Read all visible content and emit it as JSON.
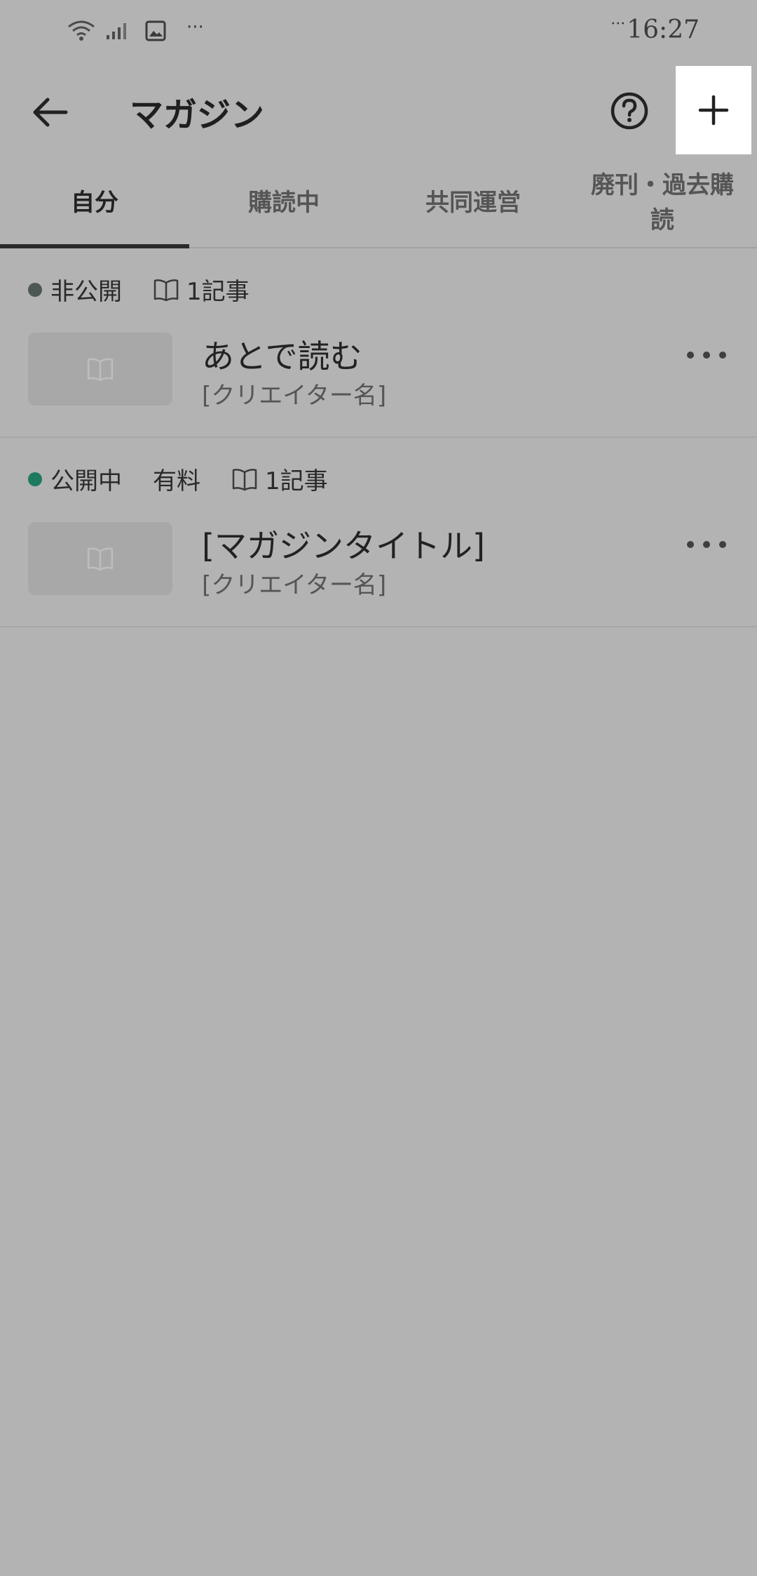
{
  "status_bar": {
    "time": "16:27",
    "left_dots": "···",
    "time_dots": "···",
    "icons": [
      "wifi-icon",
      "signal-icon",
      "image-icon"
    ]
  },
  "app_bar": {
    "title": "マガジン",
    "back_icon": "arrow-left-icon",
    "help_icon": "question-circle-icon",
    "add_icon": "plus-icon"
  },
  "tabs": [
    {
      "label": "自分",
      "active": true
    },
    {
      "label": "購読中",
      "active": false
    },
    {
      "label": "共同運営",
      "active": false
    },
    {
      "label": "廃刊・過去購読",
      "active": false
    }
  ],
  "magazines": [
    {
      "status": "非公開",
      "status_color": "#4d5754",
      "price": "",
      "article_count": "1記事",
      "title": "あとで読む",
      "creator": "[クリエイター名]"
    },
    {
      "status": "公開中",
      "status_color": "#1d7a5e",
      "price": "有料",
      "article_count": "1記事",
      "title": "[マガジンタイトル]",
      "creator": "[クリエイター名]"
    }
  ]
}
